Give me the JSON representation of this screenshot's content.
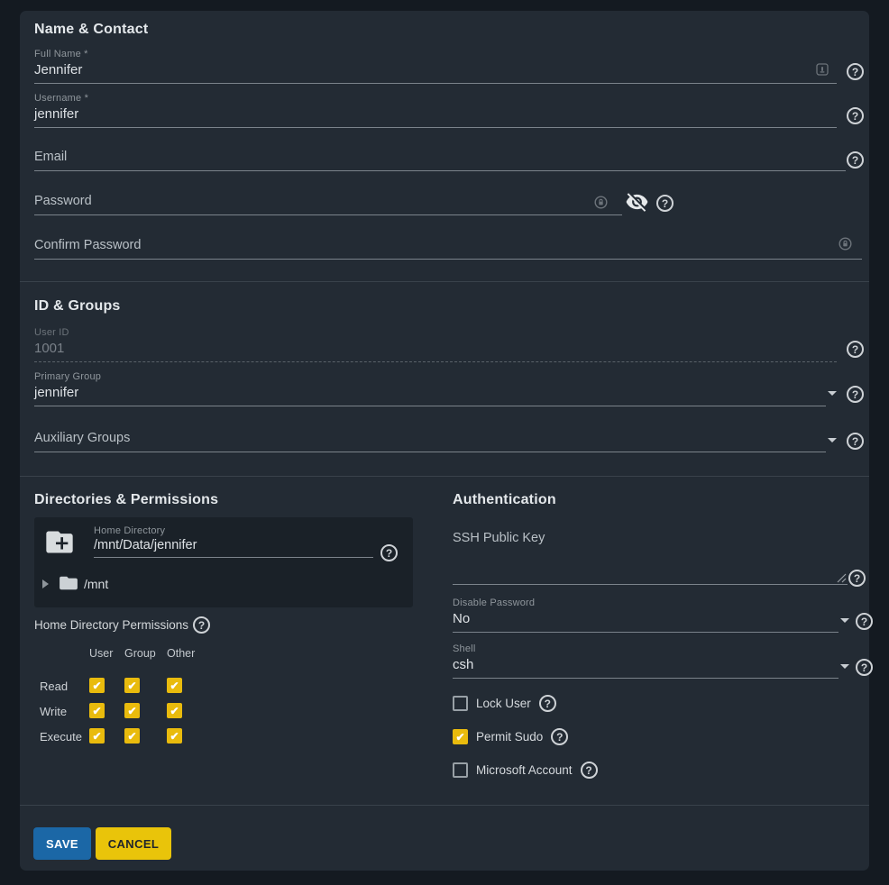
{
  "colors": {
    "accent_yellow": "#e9bb0d",
    "primary_blue": "#1b67a6",
    "card_bg": "#232b34",
    "page_bg": "#141a21"
  },
  "sections": {
    "name_contact": {
      "title": "Name & Contact",
      "fields": {
        "full_name": {
          "label": "Full Name *",
          "value": "Jennifer"
        },
        "username": {
          "label": "Username *",
          "value": "jennifer"
        },
        "email": {
          "label": "Email",
          "value": ""
        },
        "password": {
          "label": "Password",
          "value": ""
        },
        "confirm_password": {
          "label": "Confirm Password",
          "value": ""
        }
      }
    },
    "id_groups": {
      "title": "ID & Groups",
      "fields": {
        "user_id": {
          "label": "User ID",
          "value": "1001",
          "disabled": true
        },
        "primary_group": {
          "label": "Primary Group",
          "value": "jennifer"
        },
        "auxiliary_groups": {
          "label": "Auxiliary Groups",
          "value": ""
        }
      }
    },
    "directories": {
      "title": "Directories & Permissions",
      "home_directory": {
        "label": "Home Directory",
        "value": "/mnt/Data/jennifer"
      },
      "tree_root": "/mnt",
      "permissions": {
        "label": "Home Directory Permissions",
        "columns": [
          "User",
          "Group",
          "Other"
        ],
        "rows": [
          {
            "label": "Read",
            "user": true,
            "group": true,
            "other": true
          },
          {
            "label": "Write",
            "user": true,
            "group": true,
            "other": true
          },
          {
            "label": "Execute",
            "user": true,
            "group": true,
            "other": true
          }
        ]
      }
    },
    "authentication": {
      "title": "Authentication",
      "fields": {
        "ssh_public_key": {
          "label": "SSH Public Key",
          "value": ""
        },
        "disable_password": {
          "label": "Disable Password",
          "value": "No"
        },
        "shell": {
          "label": "Shell",
          "value": "csh"
        }
      },
      "checkboxes": [
        {
          "label": "Lock User",
          "checked": false
        },
        {
          "label": "Permit Sudo",
          "checked": true
        },
        {
          "label": "Microsoft Account",
          "checked": false
        }
      ]
    }
  },
  "actions": {
    "save": "SAVE",
    "cancel": "CANCEL"
  }
}
